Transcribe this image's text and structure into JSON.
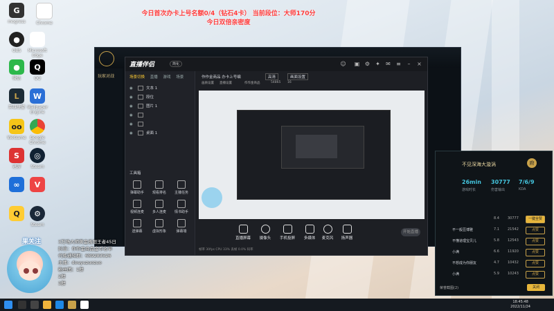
{
  "banner": {
    "line1": "今日首次办卡上号名额0/4（钻石4卡）    当前段位：大师170分",
    "line2": "今日双倍亲密度"
  },
  "desktop_icons": [
    "mogress",
    "Chrome",
    "OBS",
    "Microsoft Edge",
    "微信",
    "QQ",
    "英雄联盟",
    "Wallpaper Engine",
    "WeGame",
    "Google Chrome",
    "迅游",
    "Steam",
    "",
    "Steam"
  ],
  "lol_client": {
    "side_label": "玩家对战"
  },
  "obs": {
    "brand": "直播伴侣",
    "version": "简化",
    "tabs": [
      "场景切换",
      "直播",
      "游戏",
      "场景"
    ],
    "layers": [
      "文本 1",
      "段位",
      "图片 1",
      "",
      "",
      "桌面 1"
    ],
    "tools_title": "工具箱",
    "tools": [
      "弹幕助手",
      "观看排名",
      "主播任务",
      "视频连麦",
      "多人连麦",
      "情书助手",
      "送弹幕",
      "虚拟形象",
      "弹幕墙"
    ],
    "preview_title": "作作金商品 办卡上号编",
    "preview_tag1": "高清",
    "preview_tag2": "画面设置",
    "preview_sub1": "画质设置",
    "preview_sub2": "直播设置",
    "preview_sub3": "作作金商品",
    "preview_count": "54865",
    "preview_count2": "16",
    "bottom_buttons": [
      "直播屏幕",
      "摄像头",
      "手机投屏",
      "多媒体",
      "麦克风",
      "扬声器"
    ],
    "start_live": "开始直播",
    "status": "帧率 30fps   CPU 33%   丢帧 0.0%   码率"
  },
  "game_panel": {
    "title": "不见深海大漩涡",
    "badge": "府",
    "stats": [
      {
        "value": "26min",
        "label": "游戏时长"
      },
      {
        "value": "30777",
        "label": "伤害输出"
      },
      {
        "value": "7/6/9",
        "label": "KDA"
      }
    ],
    "rows": [
      {
        "name": "",
        "v1": "8.4",
        "v2": "30777",
        "btn": "一键全赞"
      },
      {
        "name": "不一般豆博雅",
        "v1": "7.1",
        "v2": "21542",
        "btn": "点赞"
      },
      {
        "name": "不懂道理宝贝儿",
        "v1": "5.8",
        "v2": "12543",
        "btn": "点赞"
      },
      {
        "name": "小满",
        "v1": "6.6",
        "v2": "11920",
        "btn": "点赞"
      },
      {
        "name": "不想成为你朋友",
        "v1": "4.7",
        "v2": "10432",
        "btn": "点赞"
      },
      {
        "name": "小满",
        "v1": "5.9",
        "v2": "10243",
        "btn": "点赞"
      }
    ],
    "bottom": "荣誉截图(2)",
    "close": "关闭"
  },
  "streamer": {
    "name": "果关注",
    "lines": [
      "3万场大师黄金极限王者45日",
      "抖音：作作金商品金币名单",
      "代练通知群：689283526",
      "主播：douyuzuozuo",
      "粉丝团：1群",
      "2群",
      "3群"
    ]
  },
  "taskbar": {
    "time": "18:45:48",
    "date": "2022/11/24"
  }
}
